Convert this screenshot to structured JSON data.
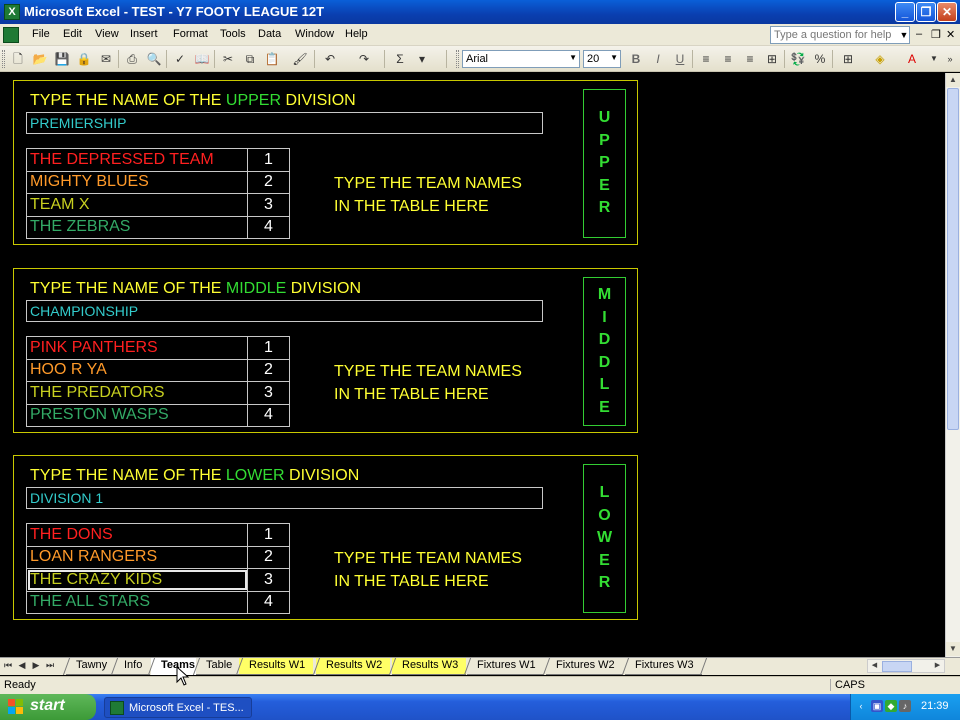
{
  "window": {
    "title": "Microsoft Excel - TEST - Y7 FOOTY LEAGUE 12T",
    "app_icon": "excel-icon"
  },
  "menu": {
    "items": [
      "File",
      "Edit",
      "View",
      "Insert",
      "Format",
      "Tools",
      "Data",
      "Window",
      "Help"
    ],
    "help_placeholder": "Type a question for help"
  },
  "toolbar": {
    "font_name": "Arial",
    "font_size": "20"
  },
  "divisions": [
    {
      "heading_pre": "TYPE THE NAME OF THE ",
      "heading_hl": "UPPER",
      "heading_post": " DIVISION",
      "name": "PREMIERSHIP",
      "teams": [
        {
          "name": "THE DEPRESSED TEAM",
          "num": "1",
          "color": "#ff2020"
        },
        {
          "name": "MIGHTY BLUES",
          "num": "2",
          "color": "#ff9a2a"
        },
        {
          "name": "TEAM X",
          "num": "3",
          "color": "#c8d020"
        },
        {
          "name": "THE ZEBRAS",
          "num": "4",
          "color": "#33aa66"
        }
      ],
      "instr_line1": "TYPE THE TEAM NAMES",
      "instr_line2": "IN THE TABLE HERE",
      "vertical_letters": [
        "U",
        "P",
        "P",
        "E",
        "R"
      ]
    },
    {
      "heading_pre": "TYPE THE NAME OF THE ",
      "heading_hl": "MIDDLE",
      "heading_post": " DIVISION",
      "name": "CHAMPIONSHIP",
      "teams": [
        {
          "name": "PINK PANTHERS",
          "num": "1",
          "color": "#ff2020"
        },
        {
          "name": "HOO R YA",
          "num": "2",
          "color": "#ff9a2a"
        },
        {
          "name": "THE PREDATORS",
          "num": "3",
          "color": "#c8d020"
        },
        {
          "name": "PRESTON WASPS",
          "num": "4",
          "color": "#33aa66"
        }
      ],
      "instr_line1": "TYPE THE TEAM NAMES",
      "instr_line2": "IN THE TABLE HERE",
      "vertical_letters": [
        "M",
        "I",
        "D",
        "D",
        "L",
        "E"
      ]
    },
    {
      "heading_pre": "TYPE THE NAME OF THE ",
      "heading_hl": "LOWER",
      "heading_post": " DIVISION",
      "name": "DIVISION 1",
      "teams": [
        {
          "name": "THE DONS",
          "num": "1",
          "color": "#ff2020"
        },
        {
          "name": "LOAN RANGERS",
          "num": "2",
          "color": "#ff9a2a"
        },
        {
          "name": "THE CRAZY KIDS",
          "num": "3",
          "color": "#c8d020"
        },
        {
          "name": "THE ALL STARS",
          "num": "4",
          "color": "#33aa66"
        }
      ],
      "instr_line1": "TYPE THE TEAM NAMES",
      "instr_line2": "IN THE TABLE HERE",
      "vertical_letters": [
        "L",
        "O",
        "W",
        "E",
        "R"
      ]
    }
  ],
  "sheet_tabs": [
    {
      "label": "Tawny",
      "yellow": false,
      "active": false
    },
    {
      "label": "Info",
      "yellow": false,
      "active": false
    },
    {
      "label": "Teams",
      "yellow": false,
      "active": true
    },
    {
      "label": "Table",
      "yellow": false,
      "active": false
    },
    {
      "label": "Results W1",
      "yellow": true,
      "active": false
    },
    {
      "label": "Results W2",
      "yellow": true,
      "active": false
    },
    {
      "label": "Results W3",
      "yellow": true,
      "active": false
    },
    {
      "label": "Fixtures W1",
      "yellow": false,
      "active": false
    },
    {
      "label": "Fixtures W2",
      "yellow": false,
      "active": false
    },
    {
      "label": "Fixtures W3",
      "yellow": false,
      "active": false
    }
  ],
  "status": {
    "ready": "Ready",
    "caps": "CAPS"
  },
  "taskbar": {
    "start_label": "start",
    "task_label": "Microsoft Excel - TES...",
    "clock": "21:39"
  }
}
